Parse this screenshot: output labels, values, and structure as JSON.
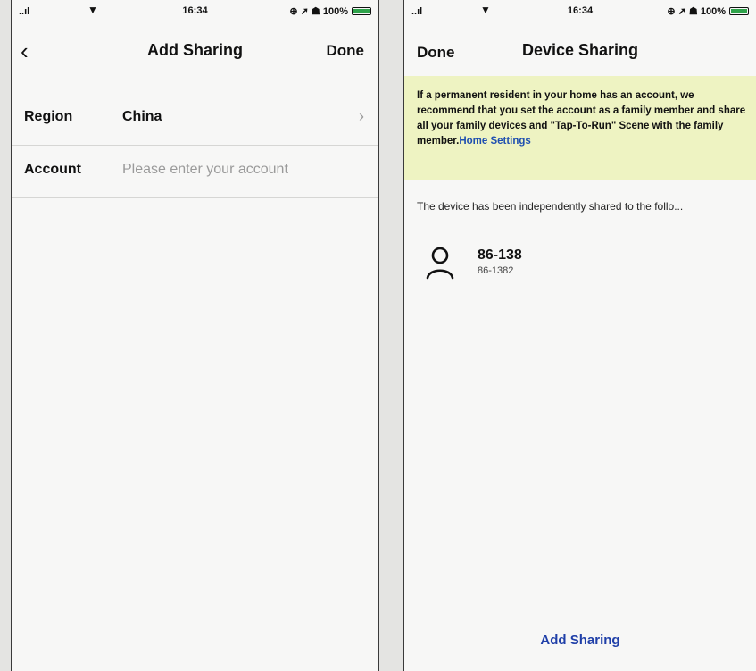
{
  "status_bar": {
    "carrier": "..ıl",
    "time": "16:34",
    "icons": "⊕ ➚ ☗ 100%",
    "wifi_icon": "wifi-icon",
    "battery_color": "#2fa34b"
  },
  "add_sharing_screen": {
    "title": "Add Sharing",
    "back_icon": "chevron-left-icon",
    "done_label": "Done",
    "region": {
      "label": "Region",
      "value": "China",
      "chevron": "›"
    },
    "account": {
      "label": "Account",
      "placeholder": "Please enter your account",
      "value": ""
    }
  },
  "device_sharing_screen": {
    "title": "Device Sharing",
    "done_label": "Done",
    "notice_text": "If a permanent resident in your home has an account, we recommend that you set the account as a family member and share all your family devices and \"Tap-To-Run\" Scene with the family member.",
    "notice_link": "Home Settings",
    "notice_bg": "#eef3c2",
    "shared_header": "The device has been independently shared to the follo...",
    "members": [
      {
        "name": "86-138",
        "id": "86-1382",
        "icon": "user-icon"
      }
    ],
    "add_sharing_label": "Add Sharing",
    "accent_color": "#1f3fa8"
  }
}
